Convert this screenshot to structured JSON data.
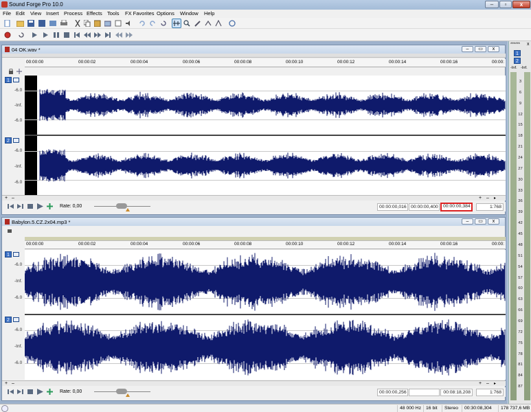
{
  "app": {
    "title": "Sound Forge Pro 10.0"
  },
  "menu": [
    "File",
    "Edit",
    "View",
    "Insert",
    "Process",
    "Effects",
    "Tools",
    "FX Favorites",
    "Options",
    "Window",
    "Help"
  ],
  "windows": [
    {
      "title": "04 OK.wav *",
      "ruler": [
        "00:00:00",
        "00:00:02",
        "00:00:04",
        "00:00:06",
        "00:00:08",
        "00:00:10",
        "00:00:12",
        "00:00:14",
        "00:00:16",
        "00:00:"
      ],
      "channels": [
        {
          "num": "1",
          "scale": [
            "-6.0",
            "-Inf.",
            "-6.0"
          ]
        },
        {
          "num": "2",
          "scale": [
            "-6.0",
            "-Inf.",
            "-6.0"
          ]
        }
      ],
      "rate_label": "Rate: 0,00",
      "sel_start": "00:00:00,016",
      "sel_end": "00:00:00,400",
      "sel_length": "00:00:00,384",
      "zoom": "1:768"
    },
    {
      "title": "Babylon.5.CZ.2x04.mp3 *",
      "ruler": [
        "00:00:00",
        "00:00:02",
        "00:00:04",
        "00:00:06",
        "00:00:08",
        "00:00:10",
        "00:00:12",
        "00:00:14",
        "00:00:16",
        "00:00:"
      ],
      "channels": [
        {
          "num": "1",
          "scale": [
            "-6.0",
            "-Inf.",
            "-6.0"
          ]
        },
        {
          "num": "2",
          "scale": [
            "-6.0",
            "-Inf.",
            "-6.0"
          ]
        }
      ],
      "rate_label": "Rate: 0,00",
      "sel_start": "00:00:00,256",
      "sel_end": "",
      "sel_length": "00:08:18,208",
      "zoom": "1:768"
    }
  ],
  "meters": {
    "header": "******",
    "ch_labels": [
      "1",
      "2"
    ],
    "top_labels": [
      "-Inf.",
      "-Inf."
    ],
    "scale": [
      "3",
      "6",
      "9",
      "12",
      "15",
      "18",
      "21",
      "24",
      "27",
      "30",
      "33",
      "36",
      "39",
      "42",
      "45",
      "48",
      "51",
      "54",
      "57",
      "60",
      "63",
      "66",
      "69",
      "72",
      "75",
      "78",
      "81",
      "84",
      "87"
    ]
  },
  "status": {
    "sample_rate": "48 000 Hz",
    "bit_depth": "16 bit",
    "channels": "Stereo",
    "length": "00:30:08,304",
    "disk": "178 737,6 MB"
  },
  "colors": {
    "waveform": "#0f1a6b",
    "accent": "#3a6fc4",
    "highlight_box": "#dd2222"
  }
}
